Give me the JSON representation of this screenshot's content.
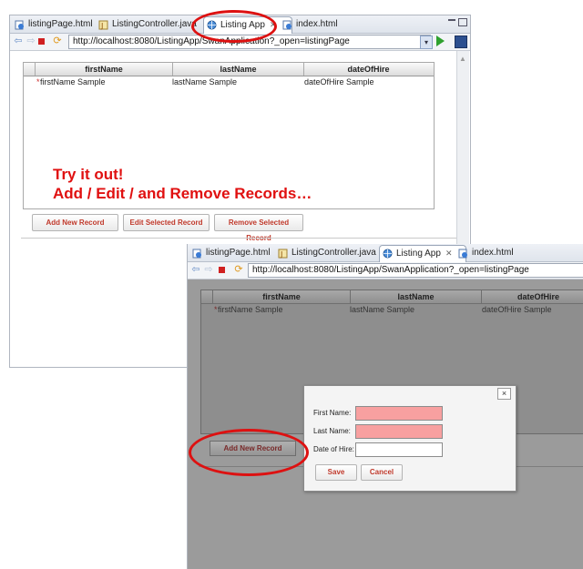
{
  "colors": {
    "accent_red": "#dd1111",
    "required_field": "#f8a0a0",
    "modal_overlay": "#9b9b9b"
  },
  "window1": {
    "tabs": [
      {
        "label": "listingPage.html",
        "icon": "html-page-icon"
      },
      {
        "label": "ListingController.java",
        "icon": "java-file-icon"
      },
      {
        "label": "Listing App",
        "icon": "browser-globe-icon",
        "active": true
      },
      {
        "label": "index.html",
        "icon": "html-page-icon"
      }
    ],
    "url": "http://localhost:8080/ListingApp/SwanApplication?_open=listingPage",
    "grid": {
      "columns": [
        "firstName",
        "lastName",
        "dateOfHire"
      ],
      "rows": [
        {
          "marker": "*",
          "firstName": "firstName Sample",
          "lastName": "lastName Sample",
          "dateOfHire": "dateOfHire Sample"
        }
      ]
    },
    "buttons": {
      "add": "Add New Record",
      "edit": "Edit Selected Record",
      "remove": "Remove Selected Record"
    }
  },
  "annotation": {
    "line1": "Try it out!",
    "line2": "Add / Edit / and Remove Records…"
  },
  "window2": {
    "tabs": [
      {
        "label": "listingPage.html",
        "icon": "html-page-icon"
      },
      {
        "label": "ListingController.java",
        "icon": "java-file-icon"
      },
      {
        "label": "Listing App",
        "icon": "browser-globe-icon",
        "active": true
      },
      {
        "label": "index.html",
        "icon": "html-page-icon"
      }
    ],
    "url": "http://localhost:8080/ListingApp/SwanApplication?_open=listingPage",
    "grid": {
      "columns": [
        "firstName",
        "lastName",
        "dateOfHire"
      ],
      "rows": [
        {
          "marker": "*",
          "firstName": "firstName Sample",
          "lastName": "lastName Sample",
          "dateOfHire": "dateOfHire Sample"
        }
      ]
    },
    "add_button": "Add New Record",
    "dialog": {
      "close": "×",
      "fields": [
        {
          "label": "First Name:",
          "value": "",
          "required": true
        },
        {
          "label": "Last Name:",
          "value": "",
          "required": true
        },
        {
          "label": "Date of Hire:",
          "value": "",
          "required": false
        }
      ],
      "save": "Save",
      "cancel": "Cancel"
    }
  }
}
